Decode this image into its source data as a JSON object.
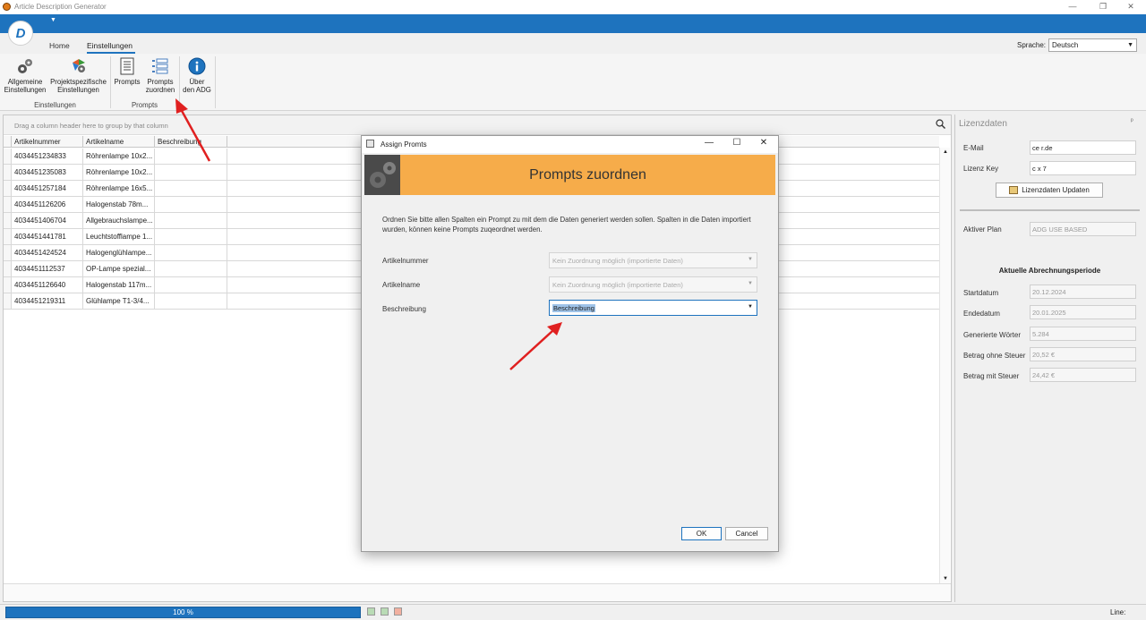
{
  "app": {
    "title": "Article Description Generator",
    "logo_glyph": "D"
  },
  "window_controls": {
    "minimize": "—",
    "restore": "❐",
    "close": "✕"
  },
  "tabs": [
    {
      "label": "Home"
    },
    {
      "label": "Einstellungen",
      "active": true
    }
  ],
  "language": {
    "label": "Sprache:",
    "value": "Deutsch"
  },
  "ribbon": {
    "buttons": [
      {
        "line1": "Allgemeine",
        "line2": "Einstellungen",
        "icon": "gears-icon"
      },
      {
        "line1": "Projektspezifische",
        "line2": "Einstellungen",
        "icon": "project-settings-icon"
      },
      {
        "line1": "Prompts",
        "line2": "",
        "icon": "document-list-icon"
      },
      {
        "line1": "Prompts",
        "line2": "zuordnen",
        "icon": "assign-prompts-icon"
      },
      {
        "line1": "Über",
        "line2": "den ADG",
        "icon": "info-icon"
      }
    ],
    "groups": [
      "Einstellungen",
      "Prompts"
    ]
  },
  "grid": {
    "group_hint": "Drag a column header here to group by that column",
    "columns": [
      "Artikelnummer",
      "Artikelname",
      "Beschreibung"
    ],
    "rows": [
      [
        "4034451234833",
        "Röhrenlampe 10x2...",
        ""
      ],
      [
        "4034451235083",
        "Röhrenlampe 10x2...",
        ""
      ],
      [
        "4034451257184",
        "Röhrenlampe 16x5...",
        ""
      ],
      [
        "4034451126206",
        "Halogenstab  78m...",
        ""
      ],
      [
        "4034451406704",
        "Allgebrauchslampe...",
        ""
      ],
      [
        "4034451441781",
        "Leuchtstofflampe 1...",
        ""
      ],
      [
        "4034451424524",
        "Halogenglühlampe...",
        ""
      ],
      [
        "4034451112537",
        "OP-Lampe spezial...",
        ""
      ],
      [
        "4034451126640",
        "Halogenstab 117m...",
        ""
      ],
      [
        "4034451219311",
        "Glühlampe T1-3/4...",
        ""
      ]
    ]
  },
  "license": {
    "title": "Lizenzdaten",
    "pin": "ᵖ",
    "email_label": "E-Mail",
    "email_value": "ce        r.de",
    "key_label": "Lizenz Key",
    "key_value": "c              x          7",
    "update_button": "Lizenzdaten Updaten",
    "plan_label": "Aktiver Plan",
    "plan_value": "ADG USE BASED",
    "period_title": "Aktuelle Abrechnungsperiode",
    "fields": [
      {
        "label": "Startdatum",
        "value": "20.12.2024"
      },
      {
        "label": "Endedatum",
        "value": "20.01.2025"
      },
      {
        "label": "Generierte Wörter",
        "value": "5.284"
      },
      {
        "label": "Betrag ohne Steuer",
        "value": "20,52 €"
      },
      {
        "label": "Betrag mit Steuer",
        "value": "24,42 €"
      }
    ]
  },
  "status": {
    "progress": "100 %",
    "progress_value": 1.0,
    "line_label": "Line:"
  },
  "dialog": {
    "title": "Assign Promts",
    "banner_title": "Prompts zuordnen",
    "description": "Ordnen Sie bitte allen Spalten ein Prompt zu mit dem die Daten generiert werden sollen. Spalten in die Daten importiert wurden, können keine Prompts zuqeordnet werden.",
    "rows": [
      {
        "label": "Artikelnummer",
        "value": "Kein Zuordnung möglich (importierte Daten)",
        "enabled": false
      },
      {
        "label": "Artikelname",
        "value": "Kein Zuordnung möglich (importierte Daten)",
        "enabled": false
      },
      {
        "label": "Beschreibung",
        "value": "Beschreibung",
        "enabled": true
      }
    ],
    "ok": "OK",
    "cancel": "Cancel"
  },
  "colors": {
    "accent": "#1e73be",
    "banner": "#f6ac4a",
    "arrow": "#e02020"
  }
}
